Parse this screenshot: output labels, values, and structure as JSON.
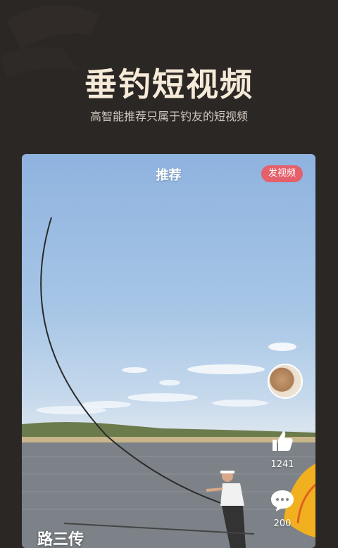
{
  "headline": "垂钓短视频",
  "subline": "高智能推荐只属于钓友的短视频",
  "card": {
    "tab_title": "推荐",
    "post_button": "发视频",
    "likes": "1241",
    "comments": "200",
    "caption": "路三传"
  },
  "colors": {
    "background": "#2b2725",
    "headline": "#f6ead8",
    "post_button": "#e4606a"
  },
  "icons": {
    "like": "thumbs-up-icon",
    "comment": "comment-bubble-icon"
  }
}
